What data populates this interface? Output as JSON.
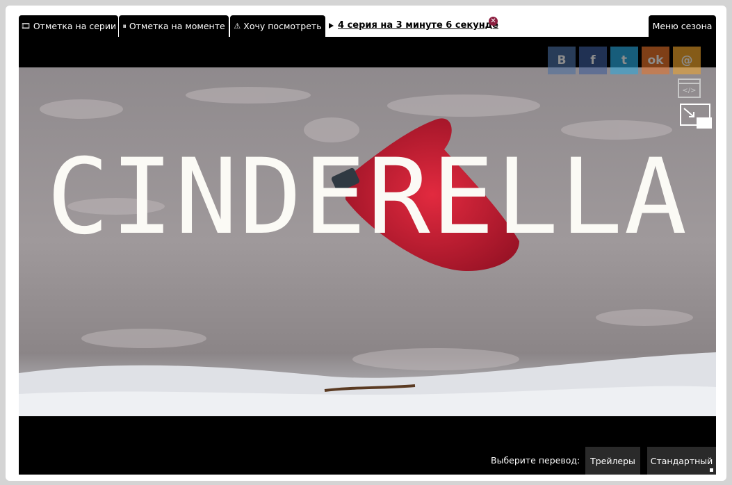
{
  "tabs": [
    {
      "label": "Отметка на серии",
      "icon": "film-icon",
      "glyph": "🎞"
    },
    {
      "label": "Отметка на моменте",
      "icon": "pause-icon",
      "glyph": "⏸"
    },
    {
      "label": "Хочу посмотреть",
      "icon": "warning-icon",
      "glyph": "⚠"
    }
  ],
  "resume": {
    "label": "4 серия на 3 минуте 6 секунде ",
    "close_glyph": "✕"
  },
  "season_menu": {
    "label": "Меню сезона"
  },
  "video": {
    "title": "CINDERELLA"
  },
  "share": [
    {
      "icon": "vk-icon",
      "glyph": "B",
      "color": "#4a6da0"
    },
    {
      "icon": "facebook-icon",
      "glyph": "f",
      "color": "#3b5998"
    },
    {
      "icon": "twitter-icon",
      "glyph": "t",
      "color": "#2aa9e0"
    },
    {
      "icon": "odnoklassniki-icon",
      "glyph": "ok",
      "color": "#e8742a"
    },
    {
      "icon": "mail-icon",
      "glyph": "@",
      "color": "#f2a62d"
    }
  ],
  "embed": {
    "glyph": "</>"
  },
  "translation": {
    "label": "Выберите перевод:",
    "options": [
      "Трейлеры",
      "Стандартный"
    ]
  }
}
